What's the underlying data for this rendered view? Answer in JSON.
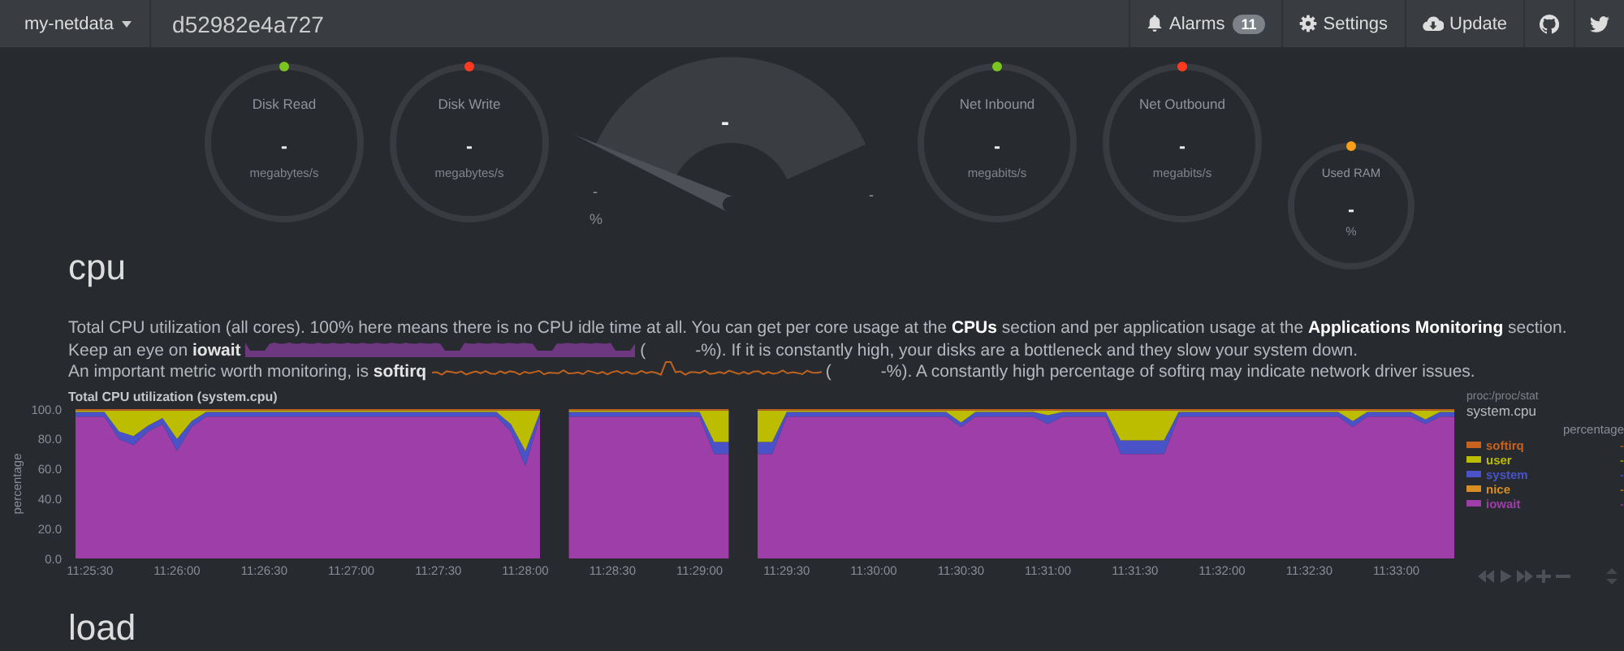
{
  "navbar": {
    "brand": "my-netdata",
    "hostname": "d52982e4a727",
    "items": [
      {
        "kind": "alarms",
        "label": "Alarms",
        "badge": "11"
      },
      {
        "kind": "settings",
        "label": "Settings"
      },
      {
        "kind": "update",
        "label": "Update"
      }
    ]
  },
  "gauges": [
    {
      "kind": "ring",
      "title": "Disk Read",
      "value": "-",
      "unit": "megabytes/s",
      "color": "#7cc520"
    },
    {
      "kind": "ring",
      "title": "Disk Write",
      "value": "-",
      "unit": "megabytes/s",
      "color": "#ff3a1f"
    },
    {
      "kind": "dial",
      "value": "-",
      "min": "-",
      "max": "-",
      "unit": "%"
    },
    {
      "kind": "ring",
      "title": "Net Inbound",
      "value": "-",
      "unit": "megabits/s",
      "color": "#7cc520"
    },
    {
      "kind": "ring",
      "title": "Net Outbound",
      "value": "-",
      "unit": "megabits/s",
      "color": "#ff3a1f"
    },
    {
      "kind": "mini",
      "title": "Used RAM",
      "value": "-",
      "unit": "%",
      "color": "#f5a018"
    }
  ],
  "sections": [
    {
      "title": "cpu",
      "description": [
        [
          {
            "kind": "text",
            "text": "Total CPU utilization (all cores). 100% here means there is no CPU idle time at all. You can get per core usage at the"
          },
          {
            "kind": "link",
            "text": "CPUs"
          },
          {
            "kind": "text",
            "text": "section and per application usage at the"
          },
          {
            "kind": "link",
            "text": "Applications Monitoring"
          },
          {
            "kind": "text",
            "text": "section."
          }
        ],
        [
          {
            "kind": "text",
            "text": "Keep an eye on **iowait**"
          },
          {
            "kind": "sparkline",
            "filled": true,
            "color": "#6e3880"
          },
          {
            "kind": "text",
            "text": "("
          },
          {
            "kind": "value",
            "text": "-"
          },
          {
            "kind": "text",
            "text": "%). If it is constantly high, your disks are a bottleneck and they slow your system down."
          }
        ],
        [
          {
            "kind": "text",
            "text": "An important metric worth monitoring, is **softirq**"
          },
          {
            "kind": "sparkline",
            "filled": false,
            "color": "#c0621e"
          },
          {
            "kind": "text",
            "text": "("
          },
          {
            "kind": "value",
            "text": "-"
          },
          {
            "kind": "text",
            "text": "%). A constantly high percentage of softirq may indicate network driver issues."
          }
        ]
      ],
      "chart": {
        "title": "Total CPU utilization (system.cpu)",
        "source": "proc:/proc/stat",
        "id": "system.cpu",
        "units": "percentage",
        "legend": [
          {
            "value": "-"
          },
          {
            "value": "-"
          },
          {
            "value": "-"
          },
          {
            "name": "nice",
            "color": "#d88e22",
            "value": "-"
          },
          {
            "value": "-"
          }
        ],
        "chart_data": {
          "type": "area",
          "stacked": true,
          "ylabel": "percentage",
          "categories": [
            null,
            "11:25:30",
            null,
            null,
            null,
            null,
            null,
            "11:26:00",
            null,
            null,
            null,
            null,
            null,
            "11:26:30",
            null,
            null,
            null,
            null,
            null,
            "11:27:00",
            null,
            null,
            null,
            null,
            null,
            "11:27:30",
            null,
            null,
            null,
            null,
            null,
            "11:28:00",
            null,
            null,
            null,
            null,
            null,
            "11:28:30",
            null,
            null,
            null,
            null,
            null,
            "11:29:00",
            null,
            null,
            null,
            null,
            null,
            "11:29:30",
            null,
            null,
            null,
            null,
            null,
            "11:30:00",
            null,
            null,
            null,
            null,
            null,
            "11:30:30",
            null,
            null,
            null,
            null,
            null,
            "11:31:00",
            null,
            null,
            null,
            null,
            null,
            "11:31:30",
            null,
            null,
            null,
            null,
            null,
            "11:32:00",
            null,
            null,
            null,
            null,
            null,
            "11:32:30",
            null,
            null,
            null,
            null,
            null,
            "11:33:00",
            null,
            null,
            null,
            null
          ],
          "ylim": [
            0,
            100
          ],
          "yticks": [
            {
              "value": 0,
              "label": "0.0"
            },
            {
              "value": 20,
              "label": "20.0"
            },
            {
              "value": 40,
              "label": "40.0"
            },
            {
              "value": 60,
              "label": "60.0"
            },
            {
              "value": 80,
              "label": "80.0"
            },
            {
              "value": 100,
              "label": "100.0"
            }
          ],
          "series": [
            {
              "name": "softirq",
              "color": "#c8621e",
              "values": [
                1,
                1,
                1,
                1,
                1,
                1,
                1,
                1,
                1,
                1,
                1,
                1,
                1,
                1,
                1,
                1,
                1,
                1,
                1,
                1,
                1,
                1,
                1,
                1,
                1,
                1,
                1,
                1,
                1,
                1,
                1,
                1,
                1,
                null,
                1,
                1,
                1,
                1,
                1,
                1,
                1,
                1,
                1,
                1,
                1,
                1,
                null,
                1,
                1,
                1,
                1,
                1,
                1,
                1,
                1,
                1,
                1,
                1,
                1,
                1,
                1,
                1,
                1,
                1,
                1,
                1,
                1,
                1,
                1,
                1,
                1,
                1,
                1,
                1,
                1,
                1,
                1,
                1,
                1,
                1,
                1,
                1,
                1,
                1,
                1,
                1,
                1,
                1,
                1,
                1,
                1,
                1,
                1,
                1,
                1,
                1
              ]
            },
            {
              "name": "user",
              "color": "#bcbc00",
              "values": [
                1,
                1,
                1,
                14,
                17,
                10,
                5,
                19,
                7,
                1,
                1,
                1,
                1,
                1,
                1,
                1,
                1,
                1,
                1,
                1,
                1,
                1,
                1,
                1,
                1,
                1,
                1,
                1,
                1,
                1,
                9,
                27,
                1,
                null,
                1,
                1,
                1,
                1,
                1,
                1,
                1,
                1,
                1,
                1,
                21,
                21,
                null,
                21,
                21,
                1,
                1,
                1,
                1,
                1,
                1,
                1,
                1,
                1,
                1,
                1,
                1,
                8,
                1,
                1,
                1,
                1,
                1,
                3,
                1,
                1,
                1,
                1,
                20,
                20,
                20,
                20,
                1,
                1,
                1,
                1,
                1,
                1,
                1,
                1,
                1,
                1,
                1,
                1,
                7,
                1,
                1,
                1,
                1,
                6,
                1,
                1
              ]
            },
            {
              "name": "system",
              "color": "#4a52c8",
              "values": [
                3,
                3,
                3,
                5,
                6,
                4,
                4,
                8,
                4,
                3,
                3,
                3,
                3,
                3,
                3,
                3,
                3,
                3,
                3,
                3,
                3,
                3,
                3,
                3,
                3,
                3,
                3,
                3,
                3,
                3,
                5,
                10,
                3,
                null,
                3,
                3,
                3,
                3,
                3,
                3,
                3,
                3,
                3,
                3,
                8,
                8,
                null,
                8,
                8,
                3,
                3,
                3,
                3,
                3,
                3,
                3,
                3,
                3,
                3,
                3,
                3,
                3,
                3,
                3,
                3,
                3,
                3,
                6,
                3,
                3,
                3,
                3,
                9,
                9,
                9,
                9,
                3,
                3,
                3,
                3,
                3,
                3,
                3,
                3,
                3,
                3,
                3,
                3,
                4,
                3,
                3,
                3,
                3,
                3,
                3,
                3
              ]
            },
            {
              "name": "iowait",
              "color": "#9e3ea8",
              "values": [
                95,
                95,
                95,
                80,
                76,
                85,
                90,
                72,
                88,
                95,
                95,
                95,
                95,
                95,
                95,
                95,
                95,
                95,
                95,
                95,
                95,
                95,
                95,
                95,
                95,
                95,
                95,
                95,
                95,
                95,
                85,
                62,
                95,
                null,
                95,
                95,
                95,
                95,
                95,
                95,
                95,
                95,
                95,
                95,
                70,
                70,
                null,
                70,
                70,
                95,
                95,
                95,
                95,
                95,
                95,
                95,
                95,
                95,
                95,
                95,
                95,
                88,
                95,
                95,
                95,
                95,
                95,
                90,
                95,
                95,
                95,
                95,
                70,
                70,
                70,
                70,
                95,
                95,
                95,
                95,
                95,
                95,
                95,
                95,
                95,
                95,
                95,
                95,
                88,
                95,
                95,
                95,
                95,
                90,
                95,
                95
              ]
            }
          ]
        }
      }
    },
    {
      "title": "load"
    }
  ]
}
